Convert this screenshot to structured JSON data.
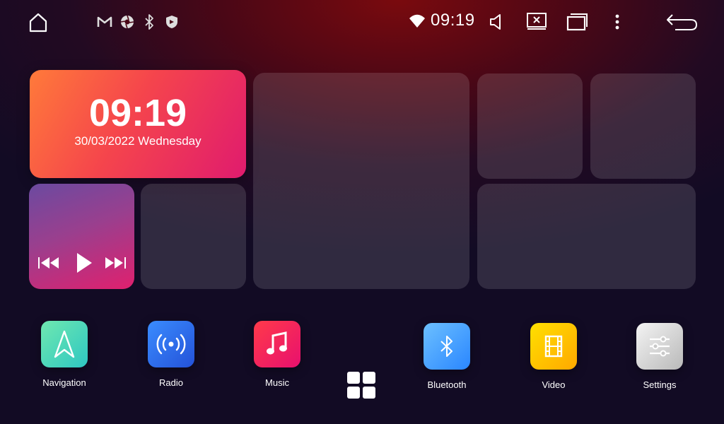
{
  "status_bar": {
    "time": "09:19",
    "icons": [
      "home-icon",
      "gmail-icon",
      "aperture-icon",
      "bluetooth-icon",
      "shield-icon",
      "wifi-icon",
      "volume-icon",
      "screen-off-icon",
      "recent-apps-icon",
      "more-icon",
      "back-icon"
    ]
  },
  "clock_widget": {
    "time": "09:19",
    "date": "30/03/2022 Wednesday"
  },
  "media_widget": {
    "controls": [
      "previous-icon",
      "play-icon",
      "next-icon"
    ]
  },
  "apps": [
    {
      "label": "Navigation",
      "icon": "navigation-icon",
      "color": "#3fd6a0"
    },
    {
      "label": "Radio",
      "icon": "radio-icon",
      "color": "#2a74f0"
    },
    {
      "label": "Music",
      "icon": "music-icon",
      "color": "#f4245c"
    },
    {
      "label": "Bluetooth",
      "icon": "bluetooth-icon",
      "color": "#3aa0ff"
    },
    {
      "label": "Video",
      "icon": "video-icon",
      "color": "#ffc400"
    },
    {
      "label": "Settings",
      "icon": "settings-icon",
      "color": "#d8d8d8"
    }
  ],
  "app_drawer": {
    "icon": "app-grid-icon"
  }
}
